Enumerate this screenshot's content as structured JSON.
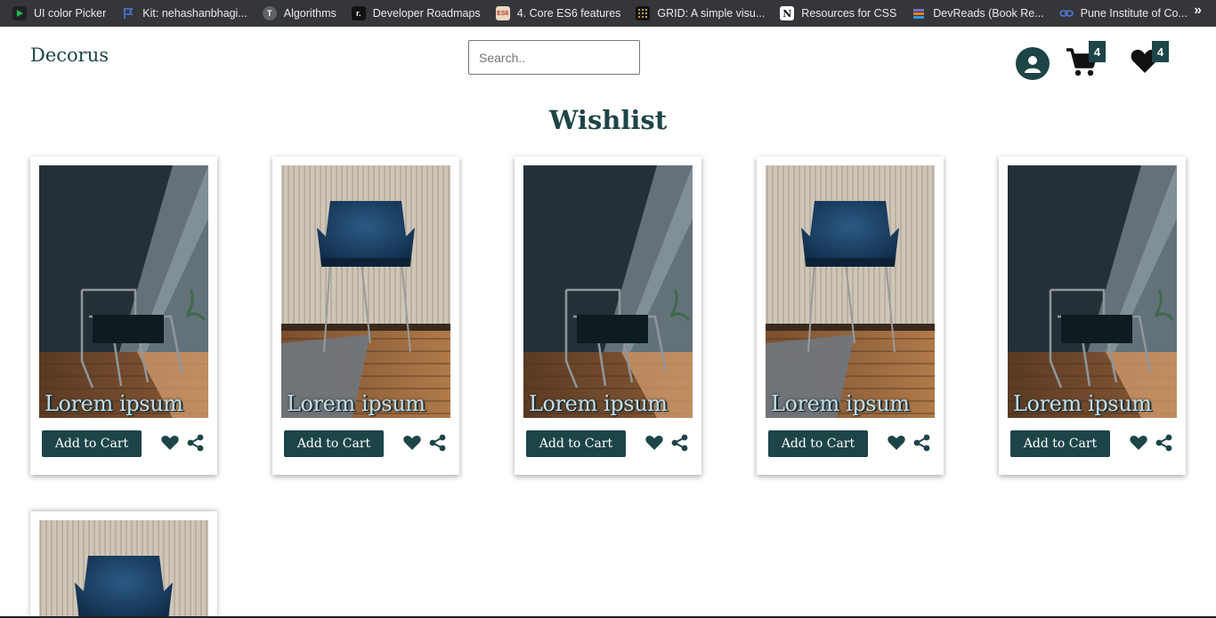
{
  "bookmarks": [
    {
      "label": "UI color Picker",
      "icon": "play-icon",
      "color": "#1db954"
    },
    {
      "label": "Kit: nehashanbhagi...",
      "icon": "flag-icon",
      "color": "#4a7bd8"
    },
    {
      "label": "Algorithms",
      "icon": "t-circle-icon",
      "color": "#5f6368"
    },
    {
      "label": "Developer Roadmaps",
      "icon": "roadmap-icon",
      "color": "#111111"
    },
    {
      "label": "4. Core ES6 features",
      "icon": "es6-icon",
      "color": "#c0392b"
    },
    {
      "label": "GRID: A simple visu...",
      "icon": "grid-dots-icon",
      "color": "#111111"
    },
    {
      "label": "Resources for CSS",
      "icon": "notion-icon",
      "color": "#ffffff"
    },
    {
      "label": "DevReads (Book Re...",
      "icon": "books-icon",
      "color": "#7b6cc9"
    },
    {
      "label": "Pune Institute of Co...",
      "icon": "link-icon",
      "color": "#4a7bd8"
    }
  ],
  "header": {
    "brand": "Decorus",
    "search_placeholder": "Search..",
    "cart_count": "4",
    "wishlist_count": "4"
  },
  "page_title": "Wishlist",
  "products": [
    {
      "name": "Lorem ipsum",
      "add_label": "Add to Cart",
      "image": "dark-wall-chair"
    },
    {
      "name": "Lorem ipsum",
      "add_label": "Add to Cart",
      "image": "blue-velvet-chair"
    },
    {
      "name": "Lorem ipsum",
      "add_label": "Add to Cart",
      "image": "dark-wall-chair"
    },
    {
      "name": "Lorem ipsum",
      "add_label": "Add to Cart",
      "image": "blue-velvet-chair"
    },
    {
      "name": "Lorem ipsum",
      "add_label": "Add to Cart",
      "image": "dark-wall-chair"
    },
    {
      "name": "",
      "add_label": "",
      "image": "blue-velvet-chair"
    }
  ],
  "colors": {
    "accent": "#1d4548",
    "bookmark_bar": "#35363a"
  }
}
